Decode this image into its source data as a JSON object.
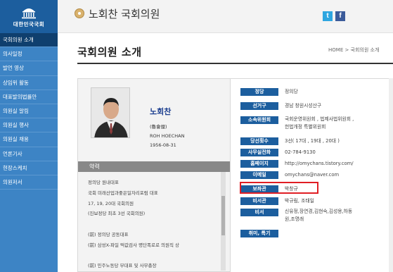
{
  "sidebar": {
    "logo_text": "대한민국국회",
    "items": [
      {
        "label": "국회의원 소개",
        "active": true
      },
      {
        "label": "의사일정"
      },
      {
        "label": "발언 영상"
      },
      {
        "label": "상임위 활동"
      },
      {
        "label": "대표발의법률안"
      },
      {
        "label": "의원실 알림"
      },
      {
        "label": "의원실 행사"
      },
      {
        "label": "의원실 채용"
      },
      {
        "label": "언론기사"
      },
      {
        "label": "현장스케치"
      },
      {
        "label": "의원저서"
      }
    ]
  },
  "header": {
    "title": "노회찬 국회의원",
    "twitter_glyph": "t",
    "facebook_glyph": "f"
  },
  "main": {
    "title": "국회의원 소개",
    "breadcrumb": "HOME > 국회의원 소개"
  },
  "profile": {
    "name_ko": "노회찬",
    "name_hanja": "(魯會燦)",
    "name_en": "ROH HOECHAN",
    "birth": "1956-08-31"
  },
  "career": {
    "header": "약력",
    "items": [
      "정의당 원내대표",
      "국회 미래산업과좋은일자리포럼 대표",
      "17, 19, 20대 국회의원",
      "(진보정당 최초 3선 국회의원)",
      "",
      "(前) 정의당 공동대표",
      "(前) 삼성X-파일 떡값검사 명단폭로로 의원직 상",
      "",
      "(前) 민주노동당 부대표 및 사무총장"
    ]
  },
  "info": {
    "rows": [
      {
        "label": "정당",
        "value": "정의당"
      },
      {
        "label": "선거구",
        "value": "경남 창원시성산구"
      },
      {
        "label": "소속위원회",
        "value": "국회운영위원회 , 법제사법위원회 ,\n헌법개정 특별위원회"
      },
      {
        "label": "당선횟수",
        "value": "3선( 17대 , 19대 , 20대 )"
      },
      {
        "label": "사무실전화",
        "value": "02-784-9130"
      },
      {
        "label": "홈페이지",
        "value": "http://omychans.tistory.com/"
      },
      {
        "label": "이메일",
        "value": "omychans@naver.com"
      },
      {
        "label": "보좌관",
        "value": "박창규"
      },
      {
        "label": "비서관",
        "value": "박규림, 조태일"
      },
      {
        "label": "비서",
        "value": "신유정,장연경,김현숙,김성용,하동\n원,조명래"
      },
      {
        "label": "취미, 특기",
        "value": ""
      }
    ]
  },
  "colors": {
    "sidebar_bg": "#3d84c5",
    "sidebar_active": "#0f3f6e",
    "label_bg": "#1c5e9e",
    "highlight": "#e01e24"
  }
}
